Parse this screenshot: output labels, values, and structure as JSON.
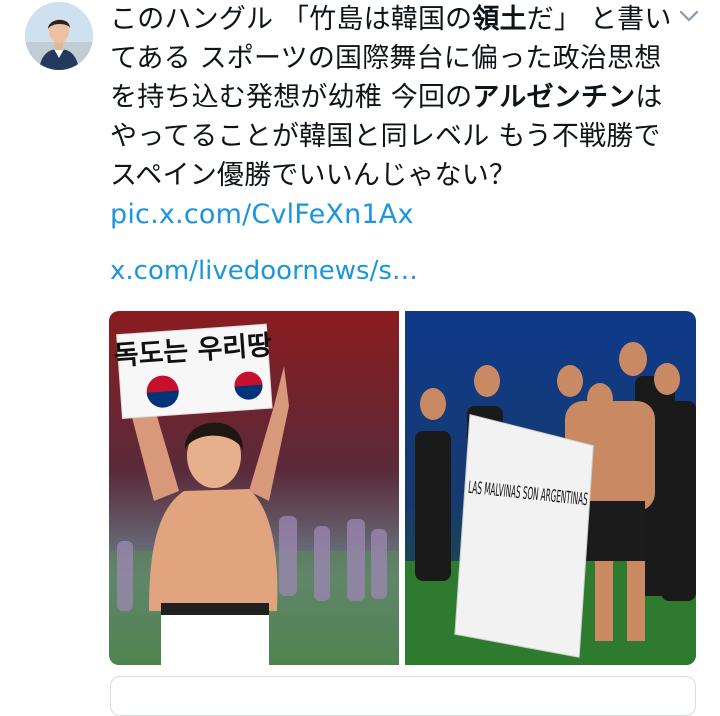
{
  "tweet": {
    "avatar_icon": "user-avatar-photo",
    "menu_icon": "chevron-down-icon",
    "text_segments": [
      {
        "text": "このハングル 「竹島は韓国の",
        "bold": false
      },
      {
        "text": "領土",
        "bold": true
      },
      {
        "text": "だ」 と書いてある スポーツの国際舞台に偏った政治思想を持ち込む発想が幼稚 今回の",
        "bold": false
      },
      {
        "text": "アルゼンチン",
        "bold": true
      },
      {
        "text": "はやってることが韓国と同レベル もう不戦勝でスペイン優勝でいいんじゃない？ ",
        "bold": false
      }
    ],
    "pic_link": "pic.x.com/CvlFeXn1Ax",
    "card_link": "x.com/livedoornews/s…",
    "media": {
      "left": {
        "banner_text": "독도는 우리땅"
      },
      "right": {
        "banner_text": "LAS MALVINAS SON ARGENTINAS"
      }
    }
  }
}
